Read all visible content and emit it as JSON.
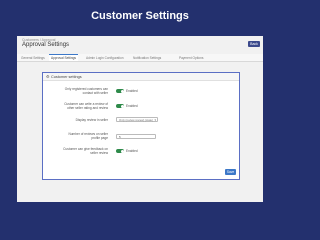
{
  "banner": {
    "title": "Customer Settings"
  },
  "page": {
    "breadcrumb": "Customers / Approval",
    "title": "Approval Settings",
    "back_label": "Back"
  },
  "tabs": [
    {
      "label": "General Settings"
    },
    {
      "label": "Approval Settings"
    },
    {
      "label": "Admin Login Configuration"
    },
    {
      "label": "Notification Settings"
    },
    {
      "label": "Payment Options"
    }
  ],
  "card": {
    "icon": "gear-icon",
    "title": "Customer settings",
    "rows": [
      {
        "label": "Only registered customers can contact with seller",
        "control": "toggle",
        "value": "Enabled"
      },
      {
        "label": "Customer can write a review of other seller rating and review",
        "control": "toggle",
        "value": "Enabled"
      },
      {
        "label": "Display review in seller",
        "control": "select",
        "value": "Only (review review) (state)"
      },
      {
        "label": "Number of reviews on seller profile page",
        "control": "number",
        "value": "5"
      },
      {
        "label": "Customer can give feedback on seller review",
        "control": "toggle",
        "value": "Enabled"
      }
    ],
    "save_label": "Save"
  },
  "colors": {
    "background": "#23306e",
    "card_border": "#5b6fc4",
    "toggle_on": "#2e8a4a",
    "primary_button": "#3c78c8"
  }
}
